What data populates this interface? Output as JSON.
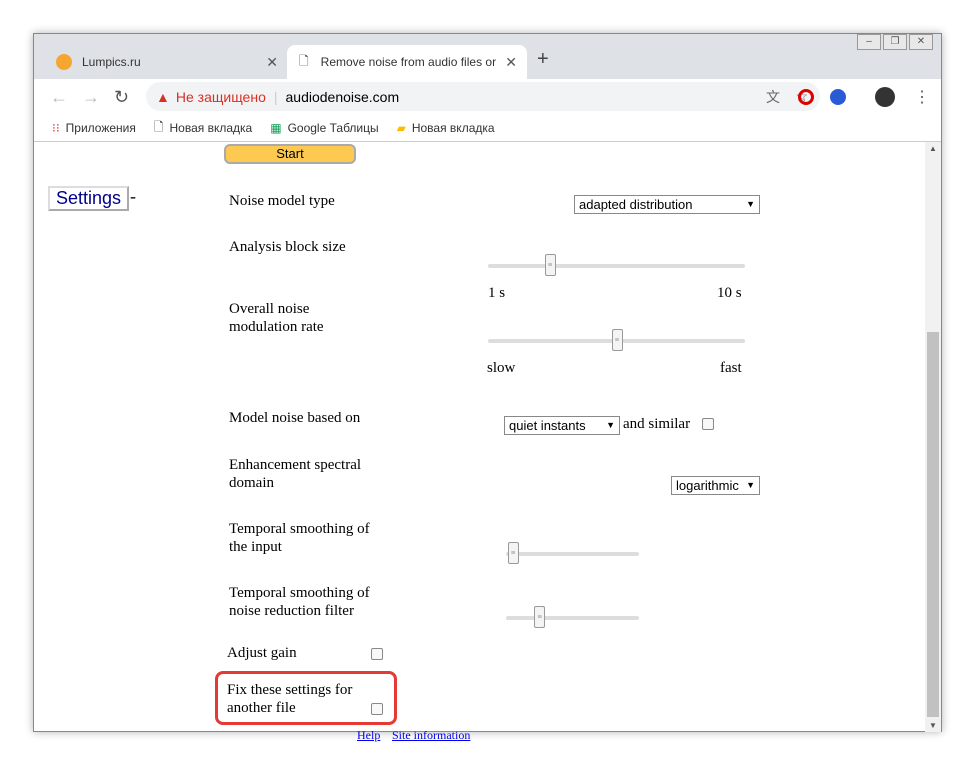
{
  "tabs": [
    {
      "title": "Lumpics.ru",
      "active": false
    },
    {
      "title": "Remove noise from audio files or",
      "active": true
    }
  ],
  "toolbar": {
    "security": "Не защищено",
    "url": "audiodenoise.com"
  },
  "bookmarks": [
    "Приложения",
    "Новая вкладка",
    "Google Таблицы",
    "Новая вкладка"
  ],
  "page": {
    "start": "Start",
    "settings": "Settings",
    "dash": "-",
    "noise_model_label": "Noise model type",
    "noise_model_value": "adapted distribution",
    "block_label": "Analysis block size",
    "block_min": "1 s",
    "block_max": "10 s",
    "block_value": 0.24,
    "mod_label_1": "Overall noise",
    "mod_label_2": "modulation rate",
    "mod_min": "slow",
    "mod_max": "fast",
    "mod_value": 0.5,
    "based_label": "Model noise based on",
    "based_value": "quiet instants",
    "similar": "and similar",
    "similar_checked": false,
    "domain_label_1": "Enhancement spectral",
    "domain_label_2": "domain",
    "domain_value": "logarithmic",
    "ts_input_1": "Temporal smoothing of",
    "ts_input_2": "the input",
    "ts_input_value": 0.05,
    "ts_filter_1": "Temporal smoothing of",
    "ts_filter_2": "noise reduction filter",
    "ts_filter_value": 0.25,
    "gain_label": "Adjust gain",
    "gain_checked": false,
    "fix_1": "Fix these settings for",
    "fix_2": "another file",
    "fix_checked": false,
    "help": "Help",
    "site_info": "Site information"
  }
}
